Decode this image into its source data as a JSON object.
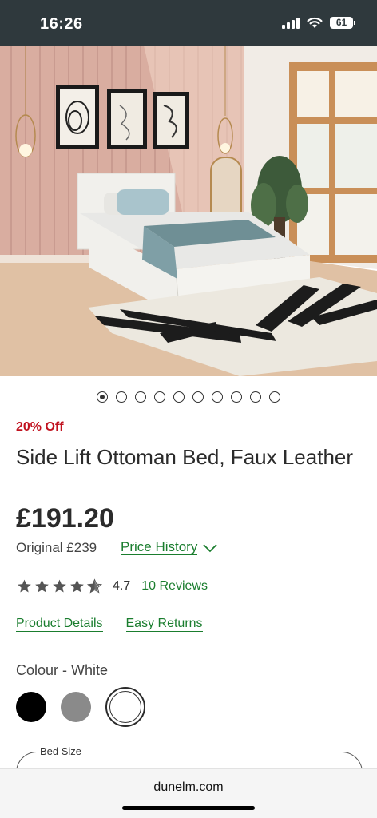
{
  "status_bar": {
    "time": "16:26",
    "battery": "61",
    "icons": [
      "signal-icon",
      "wifi-icon",
      "battery-icon"
    ]
  },
  "gallery": {
    "image_name": "white-ottoman-bed-in-bedroom",
    "total_images": 10,
    "active_index": 0
  },
  "product": {
    "discount": "20% Off",
    "title": "Side Lift Ottoman Bed, Faux Leather",
    "price": "£191.20",
    "original_price": "Original £239",
    "price_history_label": "Price History",
    "rating_value": "4.7",
    "rating_stars": 4.7,
    "reviews_label": "10 Reviews",
    "product_details_label": "Product Details",
    "easy_returns_label": "Easy Returns"
  },
  "colour": {
    "label": "Colour - White",
    "options": [
      {
        "name": "Black",
        "color": "#000000"
      },
      {
        "name": "Grey",
        "color": "#8a8a8a"
      },
      {
        "name": "White",
        "color": "#ffffff",
        "selected": true
      }
    ]
  },
  "bed_size": {
    "label": "Bed Size"
  },
  "browser": {
    "url": "dunelm.com"
  },
  "colors": {
    "status_bar_bg": "#2f393d",
    "discount_red": "#c1121f",
    "link_green": "#1a7d2e"
  }
}
